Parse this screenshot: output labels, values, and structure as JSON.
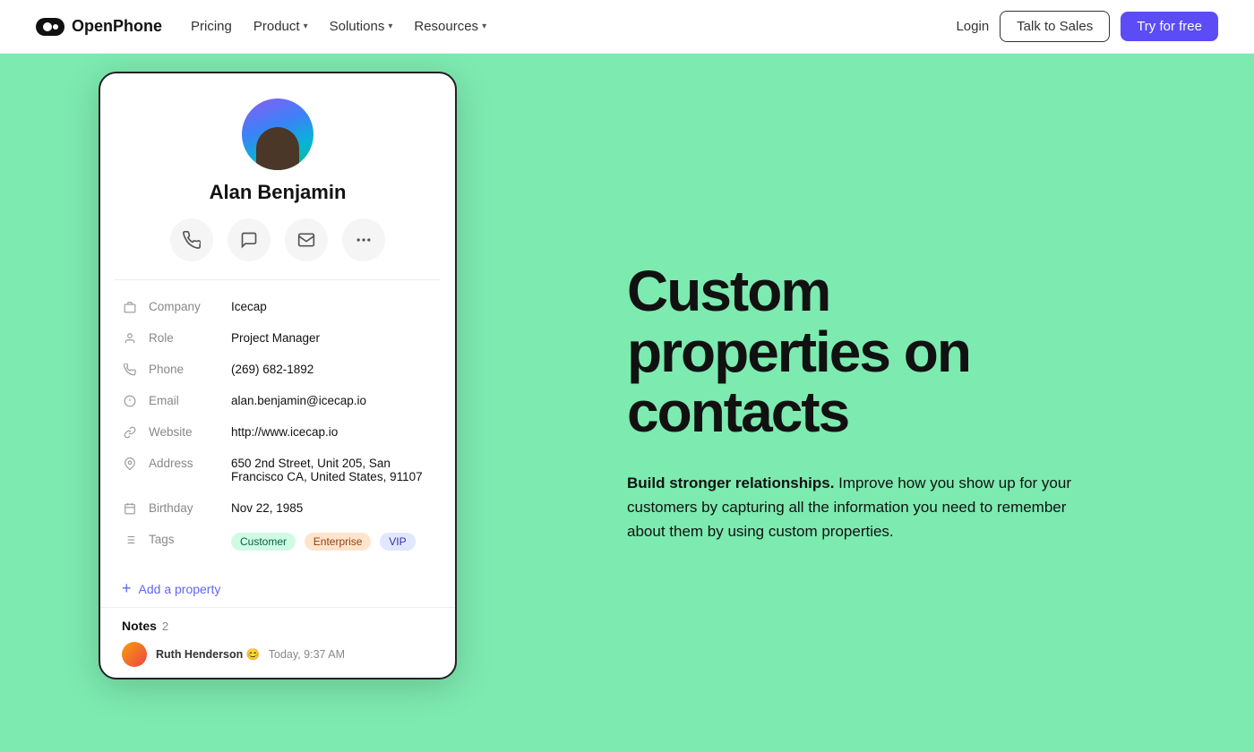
{
  "nav": {
    "logo_text": "OpenPhone",
    "links": [
      {
        "label": "Pricing",
        "has_dropdown": false
      },
      {
        "label": "Product",
        "has_dropdown": true
      },
      {
        "label": "Solutions",
        "has_dropdown": true
      },
      {
        "label": "Resources",
        "has_dropdown": true
      }
    ],
    "login_label": "Login",
    "talk_to_sales_label": "Talk to Sales",
    "try_for_free_label": "Try for free"
  },
  "contact": {
    "name": "Alan Benjamin",
    "company_label": "Company",
    "company_value": "Icecap",
    "role_label": "Role",
    "role_value": "Project Manager",
    "phone_label": "Phone",
    "phone_value": "(269) 682-1892",
    "email_label": "Email",
    "email_value": "alan.benjamin@icecap.io",
    "website_label": "Website",
    "website_value": "http://www.icecap.io",
    "address_label": "Address",
    "address_value": "650 2nd Street, Unit 205, San Francisco CA, United States, 91107",
    "birthday_label": "Birthday",
    "birthday_value": "Nov 22, 1985",
    "tags_label": "Tags",
    "tags": [
      {
        "label": "Customer",
        "class": "tag-customer"
      },
      {
        "label": "Enterprise",
        "class": "tag-enterprise"
      },
      {
        "label": "VIP",
        "class": "tag-vip"
      }
    ],
    "add_property_label": "Add a property"
  },
  "notes": {
    "label": "Notes",
    "count": "2",
    "preview_author": "Ruth Henderson",
    "preview_emoji": "😊",
    "preview_time": "Today, 9:37 AM"
  },
  "hero": {
    "title": "Custom properties on contacts",
    "desc_bold": "Build stronger relationships.",
    "desc_rest": " Improve how you show up for your customers by capturing all the information you need to remember about them by using custom properties."
  }
}
